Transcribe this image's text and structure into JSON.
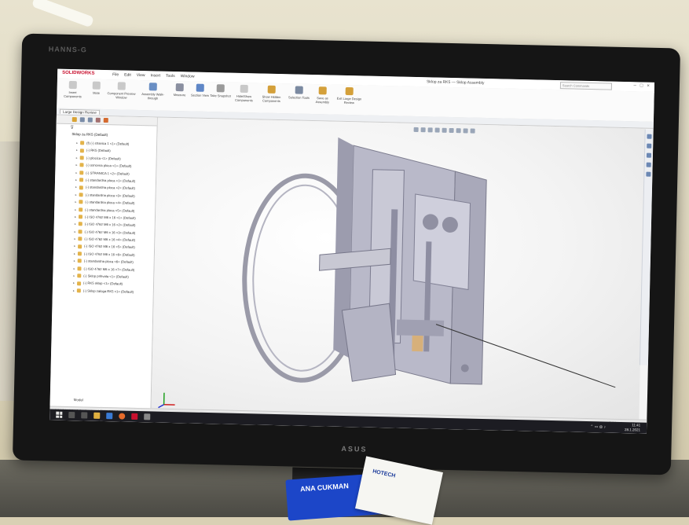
{
  "app": {
    "name": "SOLIDWORKS",
    "document_title": "Sklop za RK5 — Sklop Assembly",
    "search_placeholder": "Search Commands",
    "menu": [
      "File",
      "Edit",
      "View",
      "Insert",
      "Tools",
      "Window"
    ]
  },
  "ribbon": [
    {
      "label": "Insert Components",
      "color": "#c9c9c9"
    },
    {
      "label": "Mate",
      "color": "#c9c9c9"
    },
    {
      "label": "Component Preview Window",
      "color": "#c9c9c9"
    },
    {
      "label": "Assembly Walk-through",
      "color": "#6a8fc4"
    },
    {
      "label": "Measure",
      "color": "#8a8fa0"
    },
    {
      "label": "Section View",
      "color": "#5f87c7"
    },
    {
      "label": "Take Snapshot",
      "color": "#9a9a9a"
    },
    {
      "label": "Hide/Show Components",
      "color": "#c9c9c9"
    },
    {
      "label": "Show Hidden Components",
      "color": "#d4a03a"
    },
    {
      "label": "Selection Tools",
      "color": "#7b8aa1"
    },
    {
      "label": "Save as Assembly",
      "color": "#d4a03a"
    },
    {
      "label": "Exit Large Design Review",
      "color": "#d4a03a"
    }
  ],
  "tabs": [
    "Large Design Review"
  ],
  "tree": {
    "root": "Sklop za RK5 (Default)",
    "items": [
      "(f) (-) stranica 1 <1> (Default)",
      "(-) RK5 (Default)",
      "(-) plocica <1> (Default)",
      "(-) osnovna ploca <1> (Default)",
      "(-) STRANICA 1 <2> (Default)",
      "(-) standardna ploca <1> (Default)",
      "(-) standardna ploca <2> (Default)",
      "(-) standardna ploca <3> (Default)",
      "(-) standardna ploca <4> (Default)",
      "(-) standardna ploca <5> (Default)",
      "(-) ISO 4762 M6 x 16 <1> (Default)",
      "(-) ISO 4762 M6 x 16 <2> (Default)",
      "(-) ISO 4762 M6 x 16 <3> (Default)",
      "(-) ISO 4762 M6 x 16 <4> (Default)",
      "(-) ISO 4762 M6 x 16 <5> (Default)",
      "(-) ISO 4762 M6 x 16 <6> (Default)",
      "(-) standardna ploca <6> (Default)",
      "(-) ISO 4762 M6 x 16 <7> (Default)",
      "(-) Sklop prihvata <1> (Default)",
      "(-) RK5 sklop <1> (Default)",
      "(-) Sklop zaloga RK5 <1> (Default)"
    ],
    "bottom_tab": "Model"
  },
  "status": {
    "left": "SOLIDWORKS Professional 2021 SP1.0",
    "right": "Editing Assembly"
  },
  "taskbar": {
    "time": "11:41",
    "date": "28.1.2021"
  },
  "monitor": {
    "brand": "HANNS-G",
    "bottom_logo": "ASUS"
  },
  "desk_items": {
    "tag_text": "ANA CUKMAN",
    "paper_text": "HOTECH"
  }
}
